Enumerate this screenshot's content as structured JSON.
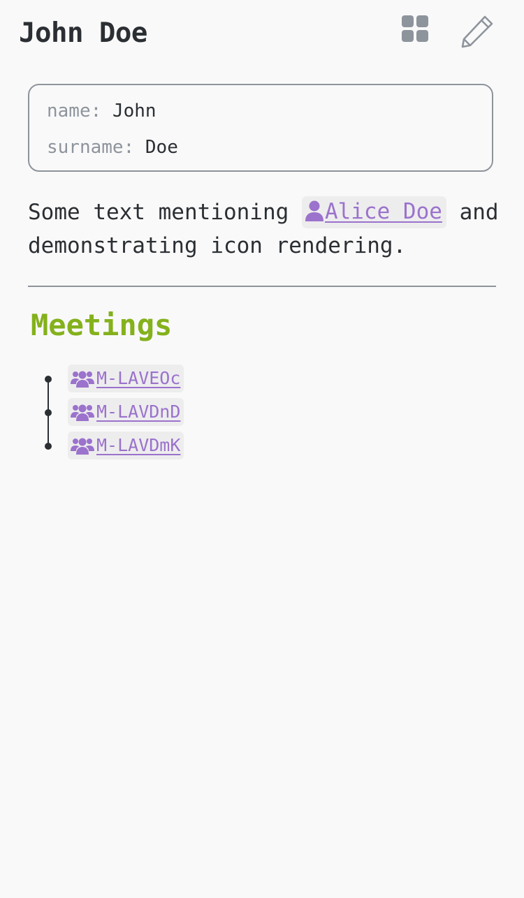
{
  "header": {
    "title": "John Doe",
    "grid_icon": "grid-view-icon",
    "edit_icon": "pencil-icon"
  },
  "properties": [
    {
      "key": "name:",
      "value": "John"
    },
    {
      "key": "surname:",
      "value": "Doe"
    }
  ],
  "content": {
    "text_before": "Some text mentioning ",
    "mention": {
      "label": "Alice Doe",
      "icon": "person-icon"
    },
    "text_after": " and demonstrating icon rendering."
  },
  "meetings": {
    "heading": "Meetings",
    "icon": "users-icon",
    "items": [
      {
        "label": "M-LAVEOc"
      },
      {
        "label": "M-LAVDnD"
      },
      {
        "label": "M-LAVDmK"
      }
    ]
  },
  "colors": {
    "text": "#2b2f33",
    "muted": "#8e949c",
    "link": "#9b72cc",
    "heading": "#84b11c",
    "chip_bg": "#ededee",
    "background": "#f9f9f9"
  }
}
